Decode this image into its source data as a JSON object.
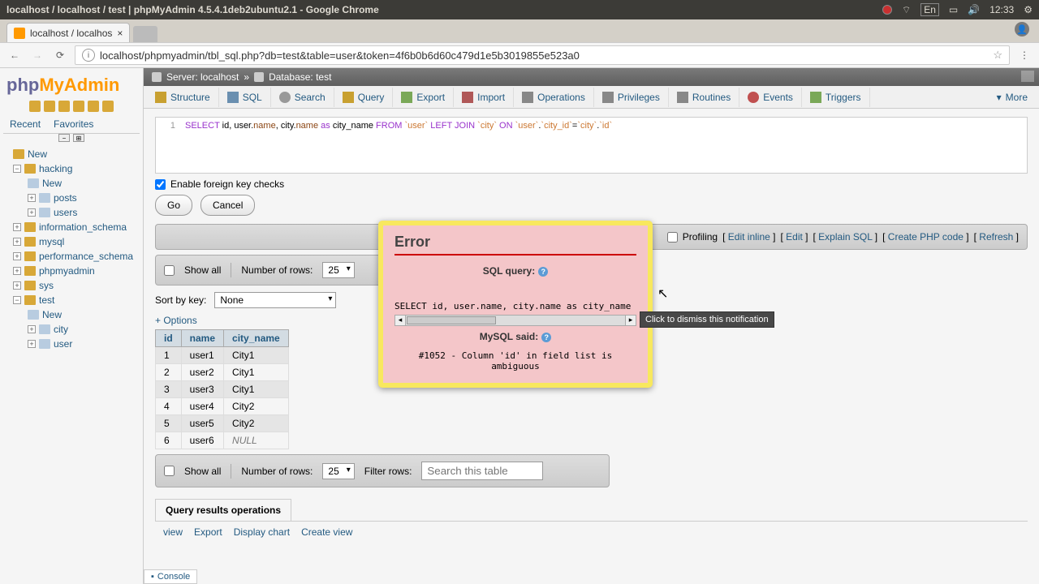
{
  "window": {
    "title": "localhost / localhost / test | phpMyAdmin 4.5.4.1deb2ubuntu2.1 - Google Chrome",
    "lang": "En",
    "time": "12:33"
  },
  "browser": {
    "tab_title": "localhost / localhos",
    "url": "localhost/phpmyadmin/tbl_sql.php?db=test&table=user&token=4f6b0b6d60c479d1e5b3019855e523a0"
  },
  "logo": {
    "p1": "php",
    "p2": "MyAdmin"
  },
  "side_tabs": {
    "recent": "Recent",
    "favorites": "Favorites"
  },
  "tree": {
    "new": "New",
    "dbs": [
      {
        "name": "hacking",
        "open": true,
        "children": [
          "New",
          "posts",
          "users"
        ]
      },
      {
        "name": "information_schema"
      },
      {
        "name": "mysql"
      },
      {
        "name": "performance_schema"
      },
      {
        "name": "phpmyadmin"
      },
      {
        "name": "sys"
      },
      {
        "name": "test",
        "open": true,
        "children": [
          "New",
          "city",
          "user"
        ]
      }
    ]
  },
  "breadcrumb": {
    "server_icon": "server",
    "server_lbl": "Server: localhost",
    "sep": "»",
    "db_icon": "database",
    "db_lbl": "Database: test"
  },
  "tabs": {
    "structure": "Structure",
    "sql": "SQL",
    "search": "Search",
    "query": "Query",
    "export": "Export",
    "import": "Import",
    "operations": "Operations",
    "privileges": "Privileges",
    "routines": "Routines",
    "events": "Events",
    "triggers": "Triggers",
    "more": "More"
  },
  "sql": {
    "line": "1",
    "code_html": "SELECT id, user.name, city.name as city_name FROM `user` LEFT JOIN `city` ON `user`.`city_id`=`city`.`id`",
    "fk_label": "Enable foreign key checks",
    "go": "Go",
    "cancel": "Cancel"
  },
  "profiling": {
    "label": "Profiling",
    "links": [
      "Edit inline",
      "Edit",
      "Explain SQL",
      "Create PHP code",
      "Refresh"
    ]
  },
  "rows_bar": {
    "show_all": "Show all",
    "num_rows_lbl": "Number of rows:",
    "num_rows_val": "25",
    "filter_lbl": "Filter rows:",
    "filter_ph": "Search this table"
  },
  "sort": {
    "lbl": "Sort by key:",
    "val": "None"
  },
  "options_link": "+ Options",
  "table": {
    "headers": [
      "id",
      "name",
      "city_name"
    ],
    "rows": [
      {
        "id": "1",
        "name": "user1",
        "city": "City1"
      },
      {
        "id": "2",
        "name": "user2",
        "city": "City1"
      },
      {
        "id": "3",
        "name": "user3",
        "city": "City1"
      },
      {
        "id": "4",
        "name": "user4",
        "city": "City2"
      },
      {
        "id": "5",
        "name": "user5",
        "city": "City2"
      },
      {
        "id": "6",
        "name": "user6",
        "city": "NULL"
      }
    ]
  },
  "qro": {
    "title": "Query results operations",
    "links": [
      "view",
      "Export",
      "Display chart",
      "Create view"
    ]
  },
  "console": "Console",
  "error": {
    "title": "Error",
    "sql_lbl": "SQL query:",
    "sql_text": "SELECT id, user.name, city.name as city_name FROM",
    "mysql_lbl": "MySQL said:",
    "msg": "#1052 - Column 'id' in field list is ambiguous"
  },
  "tooltip": "Click to dismiss this notification"
}
